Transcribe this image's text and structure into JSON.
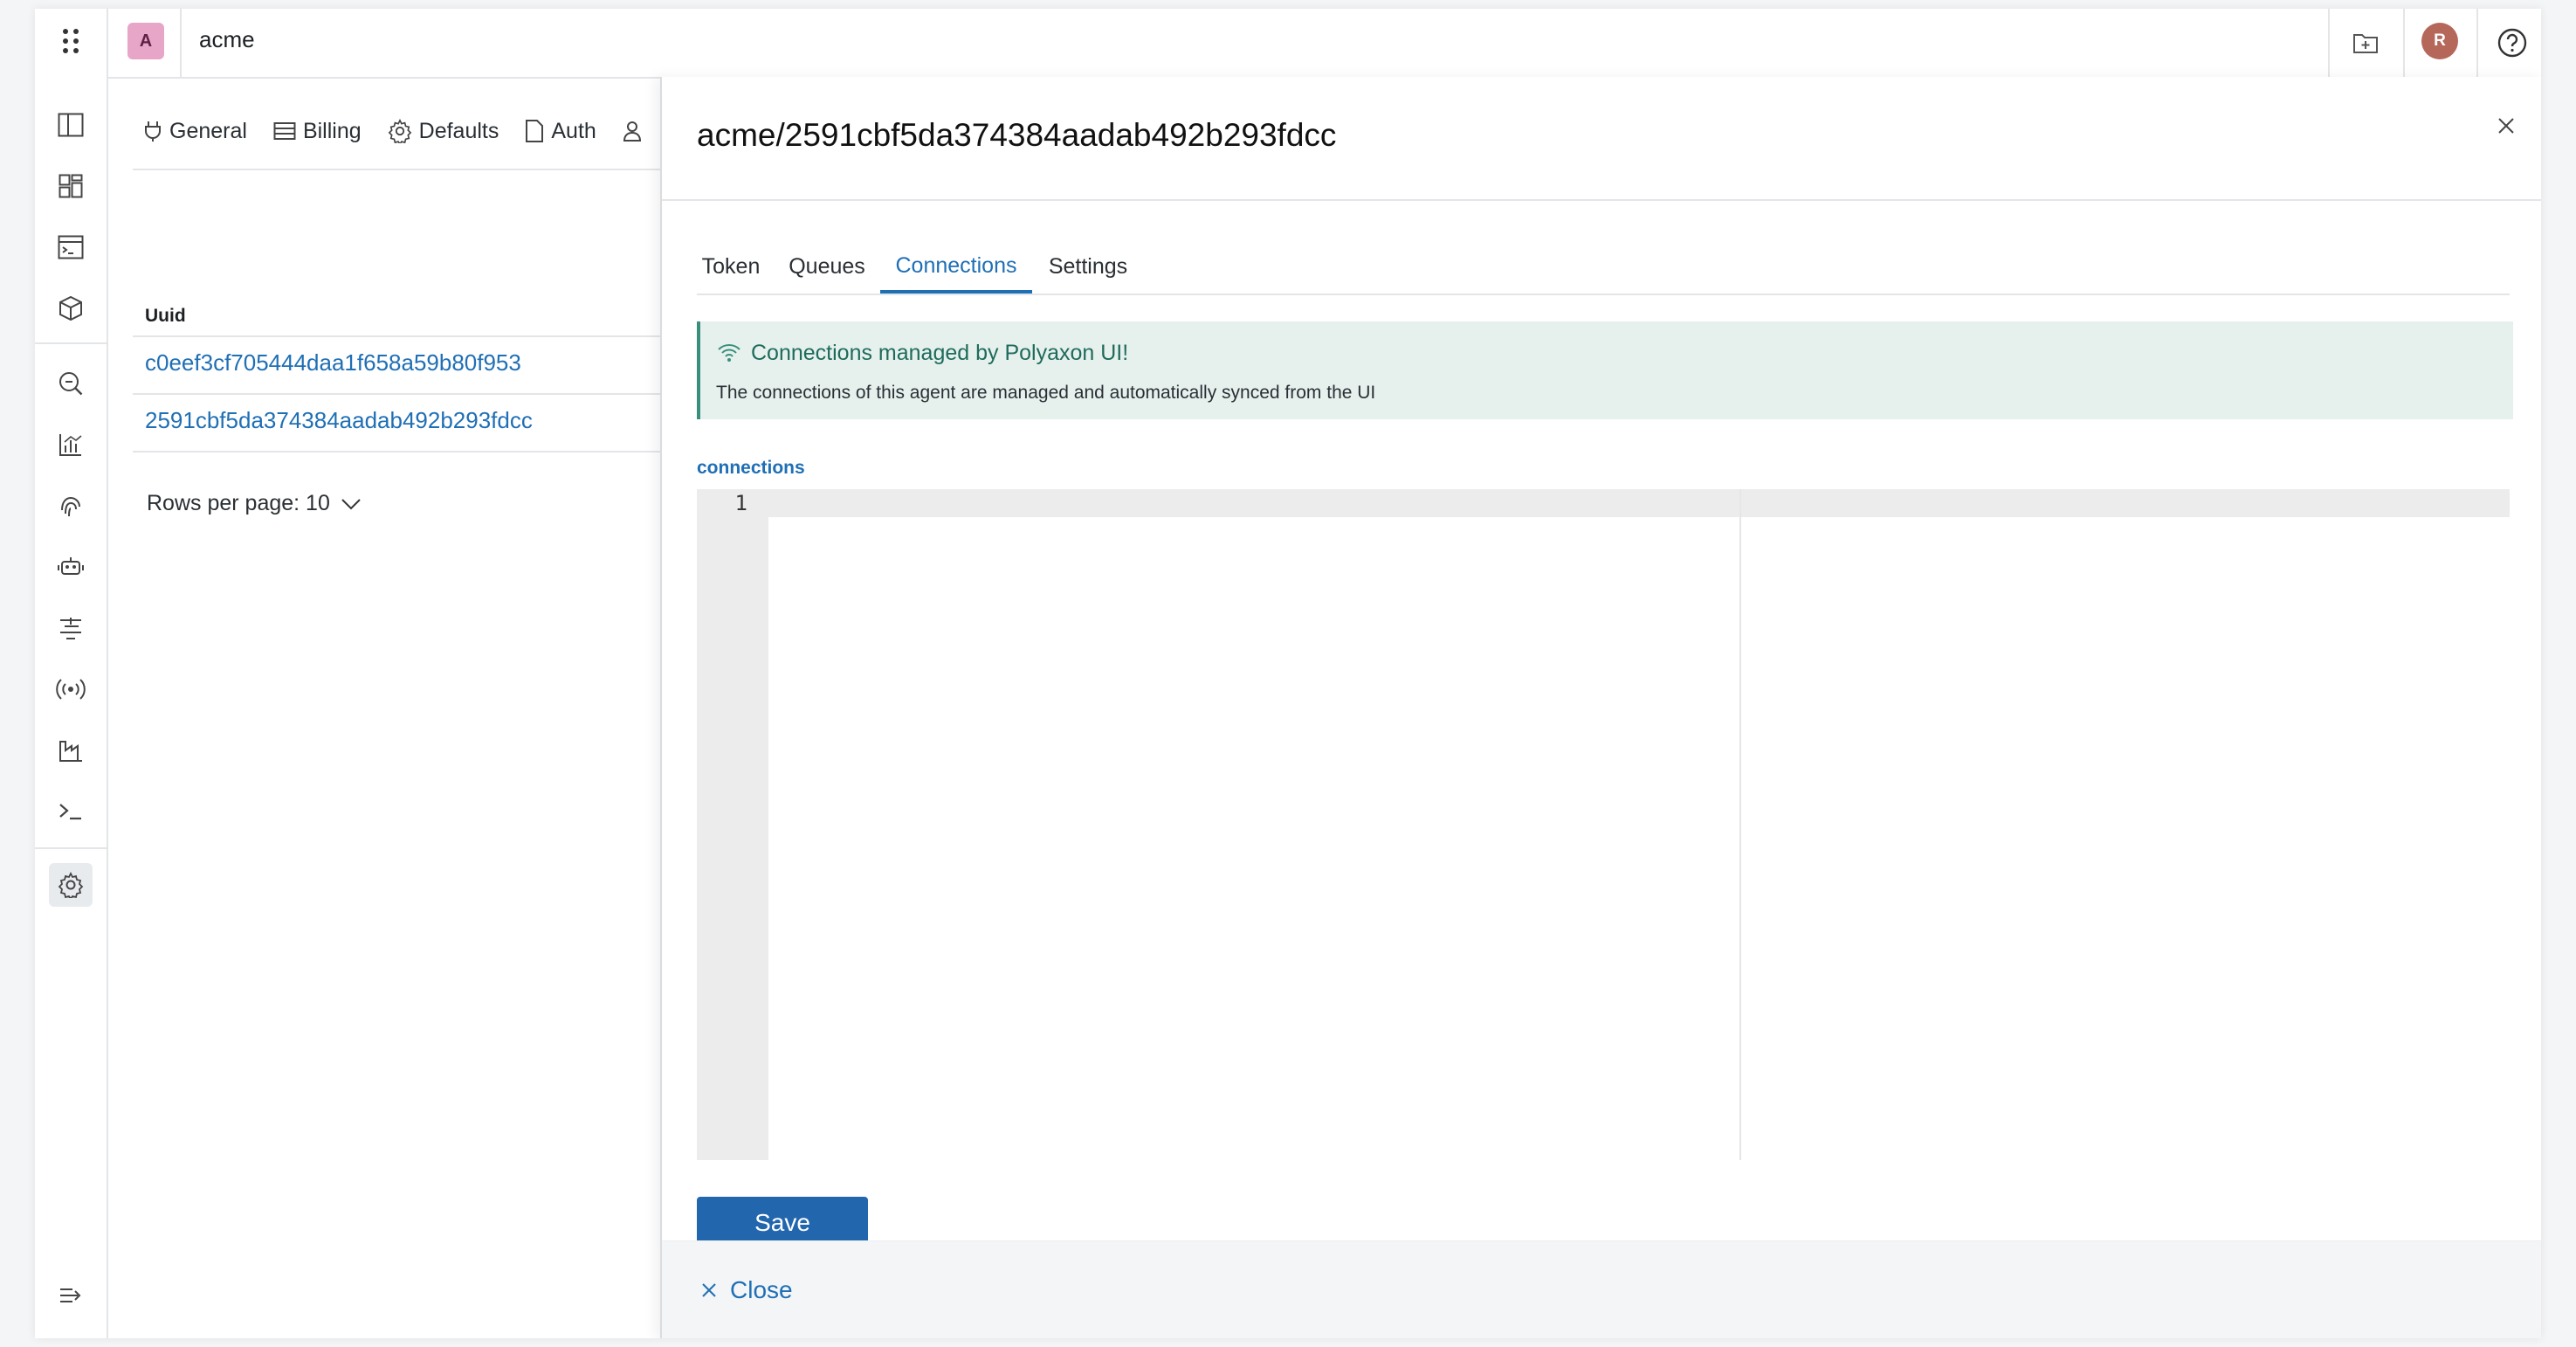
{
  "header": {
    "org_initial": "A",
    "org_name": "acme",
    "user_initial": "R"
  },
  "sidebar": {
    "items": [
      {
        "icon": "columns-icon"
      },
      {
        "icon": "dashboard-grid-icon"
      },
      {
        "icon": "terminal-panel-icon"
      },
      {
        "icon": "cube-icon"
      },
      {
        "icon": "search-zoom-icon"
      },
      {
        "icon": "chart-bars-icon"
      },
      {
        "icon": "fingerprint-icon"
      },
      {
        "icon": "robot-icon"
      },
      {
        "icon": "filter-lines-icon"
      },
      {
        "icon": "signal-broadcast-icon"
      },
      {
        "icon": "factory-icon"
      },
      {
        "icon": "terminal-prompt-icon"
      },
      {
        "icon": "gear-icon",
        "active": true
      }
    ],
    "collapse_icon": "collapse-arrow-icon"
  },
  "main": {
    "tabs": [
      {
        "label": "General",
        "icon": "plug-icon"
      },
      {
        "label": "Billing",
        "icon": "billing-icon"
      },
      {
        "label": "Defaults",
        "icon": "gear-icon"
      },
      {
        "label": "Auth",
        "icon": "document-icon"
      }
    ],
    "table": {
      "column": "Uuid",
      "rows": [
        "c0eef3cf705444daa1f658a59b80f953",
        "2591cbf5da374384aadab492b293fdcc"
      ]
    },
    "rows_per_page": "Rows per page: 10"
  },
  "drawer": {
    "title": "acme/2591cbf5da374384aadab492b293fdcc",
    "tabs": [
      "Token",
      "Queues",
      "Connections",
      "Settings"
    ],
    "active_tab": "Connections",
    "callout": {
      "title": "Connections managed by Polyaxon UI!",
      "body": "The connections of this agent are managed and automatically synced from the UI"
    },
    "field_label": "connections",
    "editor": {
      "line_numbers": [
        "1"
      ],
      "content": ""
    },
    "save_label": "Save",
    "close_label": "Close"
  },
  "colors": {
    "accent": "#1f6fb5",
    "save_button": "#2266ad",
    "callout_bg": "#e6f1ee",
    "callout_text": "#1f6b5a",
    "org_avatar": "#e7a6c8",
    "user_avatar": "#b5685a"
  }
}
